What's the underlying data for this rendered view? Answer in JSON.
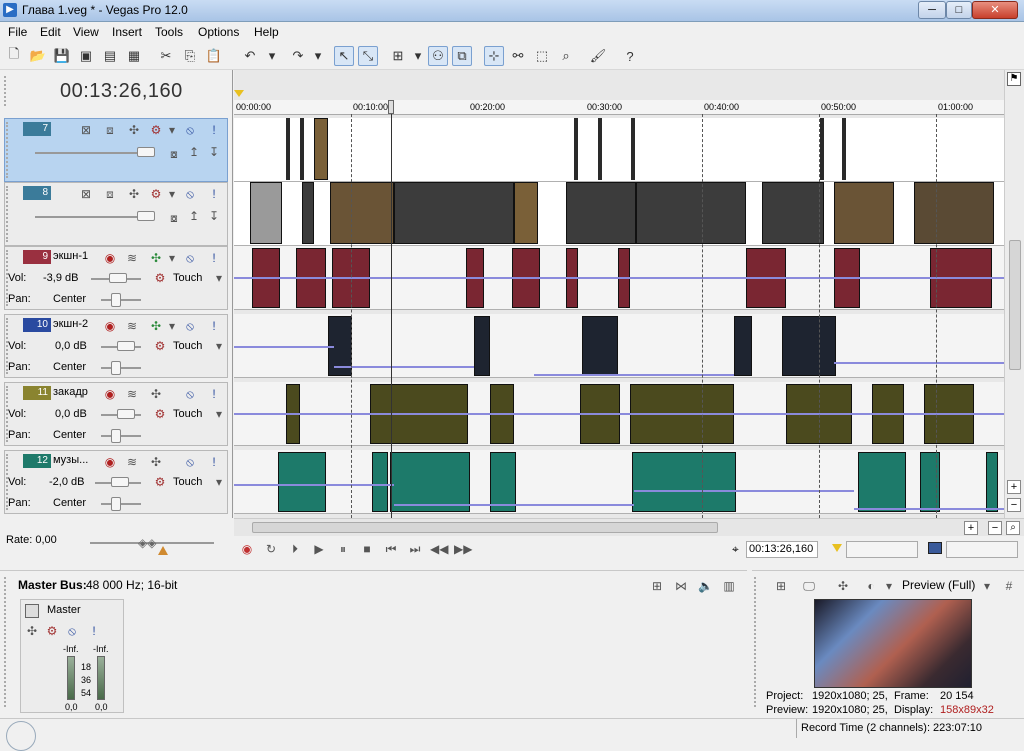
{
  "window": {
    "title": "Глава 1.veg * - Vegas Pro 12.0",
    "min": "─",
    "max": "□",
    "close": "✕"
  },
  "menu": [
    "File",
    "Edit",
    "View",
    "Insert",
    "Tools",
    "Options",
    "Help"
  ],
  "timecode": "00:13:26,160",
  "ruler": [
    "00:00:00",
    "00:10:00",
    "00:20:00",
    "00:30:00",
    "00:40:00",
    "00:50:00",
    "01:00:00"
  ],
  "tracks": [
    {
      "num": "7",
      "name": "",
      "type": "video",
      "color": "#3b7b9a"
    },
    {
      "num": "8",
      "name": "",
      "type": "video",
      "color": "#3b7b9a"
    },
    {
      "num": "9",
      "name": "экшн-1",
      "type": "audio",
      "color": "#9a3040",
      "vol_label": "Vol:",
      "vol": "-3,9 dB",
      "pan_label": "Pan:",
      "pan": "Center",
      "mode": "Touch"
    },
    {
      "num": "10",
      "name": "экшн-2",
      "type": "audio",
      "color": "#2a4aa0",
      "vol_label": "Vol:",
      "vol": "0,0 dB",
      "pan_label": "Pan:",
      "pan": "Center",
      "mode": "Touch"
    },
    {
      "num": "11",
      "name": "закадр",
      "type": "audio",
      "color": "#8a8430",
      "vol_label": "Vol:",
      "vol": "0,0 dB",
      "pan_label": "Pan:",
      "pan": "Center",
      "mode": "Touch"
    },
    {
      "num": "12",
      "name": "музы...",
      "type": "audio",
      "color": "#1e7a6a",
      "vol_label": "Vol:",
      "vol": "-2,0 dB",
      "pan_label": "Pan:",
      "pan": "Center",
      "mode": "Touch"
    }
  ],
  "transport": {
    "rate": "Rate: 0,00",
    "timecode": "00:13:26,160"
  },
  "master": {
    "title": "Master Bus:",
    "info": "48 000 Hz; 16-bit",
    "label": "Master",
    "inf_left": "-Inf.",
    "inf_right": "-Inf.",
    "scale": [
      "18",
      "36",
      "54"
    ],
    "val_left": "0,0",
    "val_right": "0,0"
  },
  "preview": {
    "mode": "Preview (Full)",
    "project_label": "Project:",
    "project": "1920x1080; 25,",
    "frame_label": "Frame:",
    "frame": "20 154",
    "preview_label": "Preview:",
    "preview_val": "1920x1080; 25,",
    "display_label": "Display:",
    "display": "158x89x32"
  },
  "status": "Record Time (2 channels): 223:07:10"
}
